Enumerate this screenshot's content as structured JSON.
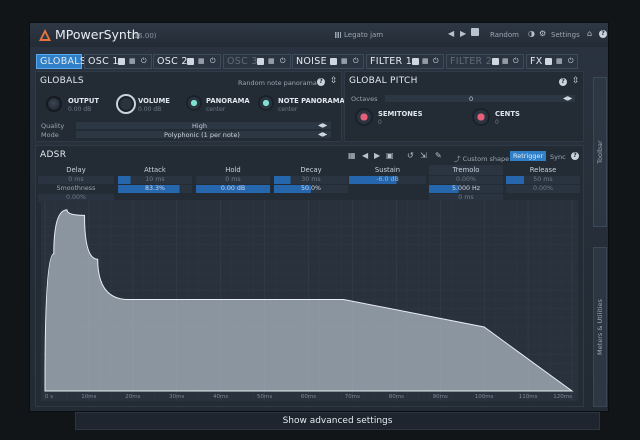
{
  "titlebar": {
    "app_name": "MPowerSynth",
    "version": "(16.00)",
    "preset": "Legato jam",
    "random_label": "Random",
    "settings_label": "Settings"
  },
  "tabs": [
    {
      "label": "GLOBALS",
      "selected": true
    },
    {
      "label": "OSC 1"
    },
    {
      "label": "OSC 2"
    },
    {
      "label": "OSC 3",
      "disabled": true
    },
    {
      "label": "NOISE"
    },
    {
      "label": "FILTER 1"
    },
    {
      "label": "FILTER 2",
      "disabled": true
    },
    {
      "label": "FX"
    }
  ],
  "sidebar": {
    "toolbar_label": "Toolbar",
    "meters_label": "Meters & Utilities"
  },
  "globals": {
    "title": "GLOBALS",
    "random_note_panorama": "Random note panorama",
    "knobs": [
      {
        "label": "OUTPUT",
        "value": "0.00 dB"
      },
      {
        "label": "VOLUME",
        "value": "0.00 dB"
      },
      {
        "label": "PANORAMA",
        "value": "center"
      },
      {
        "label": "NOTE PANORAMA",
        "value": "center"
      }
    ],
    "quality_label": "Quality",
    "quality_value": "High",
    "mode_label": "Mode",
    "mode_value": "Polyphonic (1 per note)"
  },
  "global_pitch": {
    "title": "GLOBAL PITCH",
    "octaves_label": "Octaves",
    "octaves_value": "0",
    "semitones_label": "SEMITONES",
    "semitones_value": "0",
    "cents_label": "CENTS",
    "cents_value": "0"
  },
  "adsr": {
    "title": "ADSR",
    "custom_shape_label": "Custom shape",
    "retrigger_label": "Retrigger",
    "sync_label": "Sync",
    "columns": [
      {
        "header": "Delay",
        "rows": [
          "0 ms",
          "Smoothness",
          "0.00%"
        ]
      },
      {
        "header": "Attack",
        "rows": [
          "10 ms",
          "83.3%"
        ]
      },
      {
        "header": "Hold",
        "rows": [
          "0 ms",
          "0.00 dB"
        ]
      },
      {
        "header": "Decay",
        "rows": [
          "30 ms",
          "50.0%"
        ]
      },
      {
        "header": "Sustain",
        "rows": [
          "-6.0 dB"
        ]
      },
      {
        "header": "Tremolo",
        "rows": [
          "0.00%",
          "5.000 Hz",
          "0 ms"
        ]
      },
      {
        "header": "Release",
        "rows": [
          "50 ms",
          "0.00%"
        ]
      }
    ]
  },
  "chart_data": {
    "type": "area",
    "title": "",
    "xlabel": "",
    "ylabel": "",
    "x": [
      0,
      2,
      5,
      9,
      12,
      19,
      24,
      28,
      30,
      68,
      100,
      120
    ],
    "y": [
      0.05,
      0.75,
      0.99,
      0.96,
      0.72,
      0.5,
      0.5,
      0.5,
      0.5,
      0.5,
      0.35,
      0.0
    ],
    "x_unit": "ms",
    "xlim": [
      0,
      120
    ],
    "ylim": [
      0,
      1
    ],
    "x_tick_labels": [
      "0 s",
      "10ms",
      "20ms",
      "30ms",
      "40ms",
      "50ms",
      "60ms",
      "70ms",
      "80ms",
      "90ms",
      "100ms",
      "110ms",
      "120ms"
    ],
    "grid": true
  },
  "footer": {
    "advanced_label": "Show advanced settings"
  },
  "colors": {
    "accent": "#2f7fc9",
    "knob_cyan": "#7fe0d0",
    "knob_pink": "#e85f7a"
  }
}
